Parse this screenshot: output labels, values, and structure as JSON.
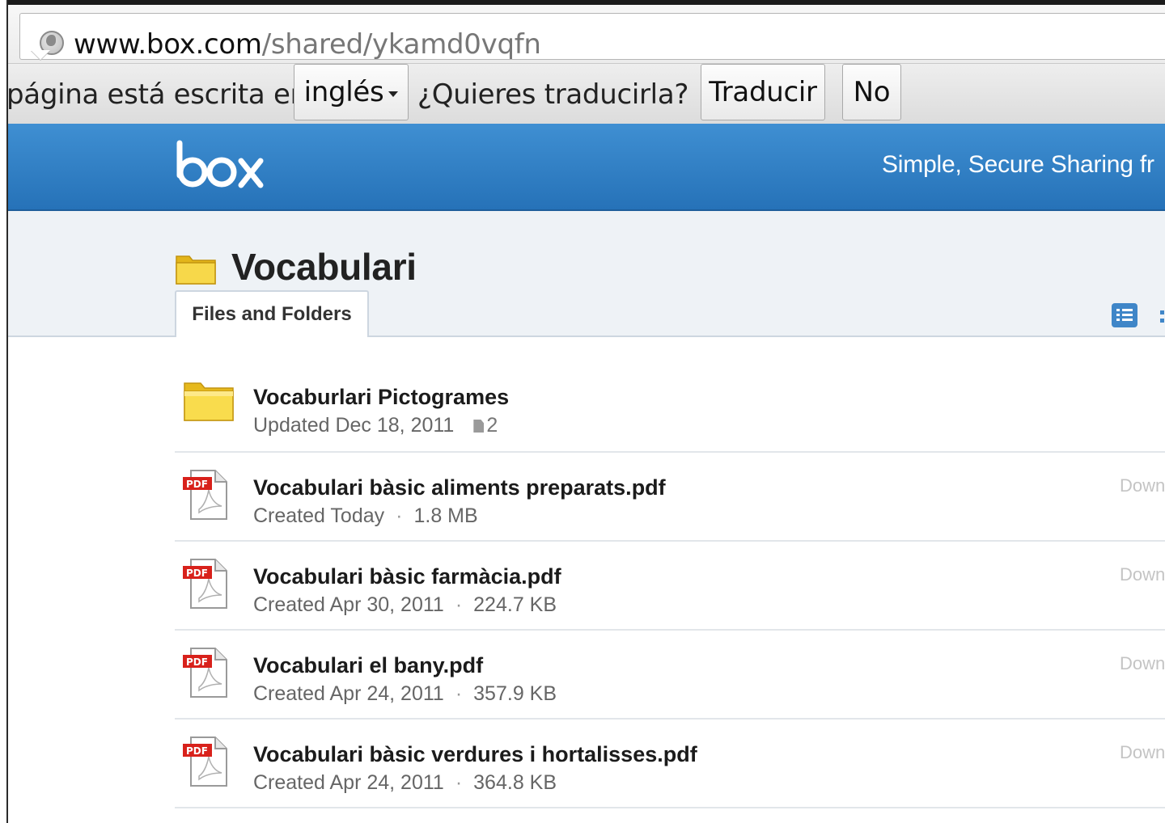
{
  "browser": {
    "url_host": "www.box.com",
    "url_path": "/shared/ykamd0vqfn"
  },
  "translate_bar": {
    "prefix": "página está escrita en",
    "language": "inglés",
    "question": "¿Quieres traducirla?",
    "translate_button": "Traducir",
    "no_button": "No"
  },
  "header": {
    "logo": "box",
    "tagline": "Simple, Secure Sharing fr"
  },
  "folder": {
    "title": "Vocabulari",
    "tab_label": "Files and Folders"
  },
  "items": [
    {
      "type": "folder",
      "name": "Vocaburlari Pictogrames",
      "meta": "Updated Dec 18, 2011",
      "count": "2",
      "download": ""
    },
    {
      "type": "pdf",
      "name": "Vocabulari bàsic aliments preparats.pdf",
      "meta": "Created Today",
      "size": "1.8 MB",
      "download": "Down"
    },
    {
      "type": "pdf",
      "name": "Vocabulari bàsic farmàcia.pdf",
      "meta": "Created Apr 30, 2011",
      "size": "224.7 KB",
      "download": "Down"
    },
    {
      "type": "pdf",
      "name": "Vocabulari el bany.pdf",
      "meta": "Created Apr 24, 2011",
      "size": "357.9 KB",
      "download": "Down"
    },
    {
      "type": "pdf",
      "name": "Vocabulari bàsic verdures i hortalisses.pdf",
      "meta": "Created Apr 24, 2011",
      "size": "364.8 KB",
      "download": "Down"
    }
  ],
  "icons": {
    "pdf_badge": "PDF"
  },
  "colors": {
    "header_blue": "#2f7fc6",
    "accent_blue": "#3f86c8",
    "pdf_red": "#d8211b",
    "folder_yellow": "#f2cf2b"
  }
}
